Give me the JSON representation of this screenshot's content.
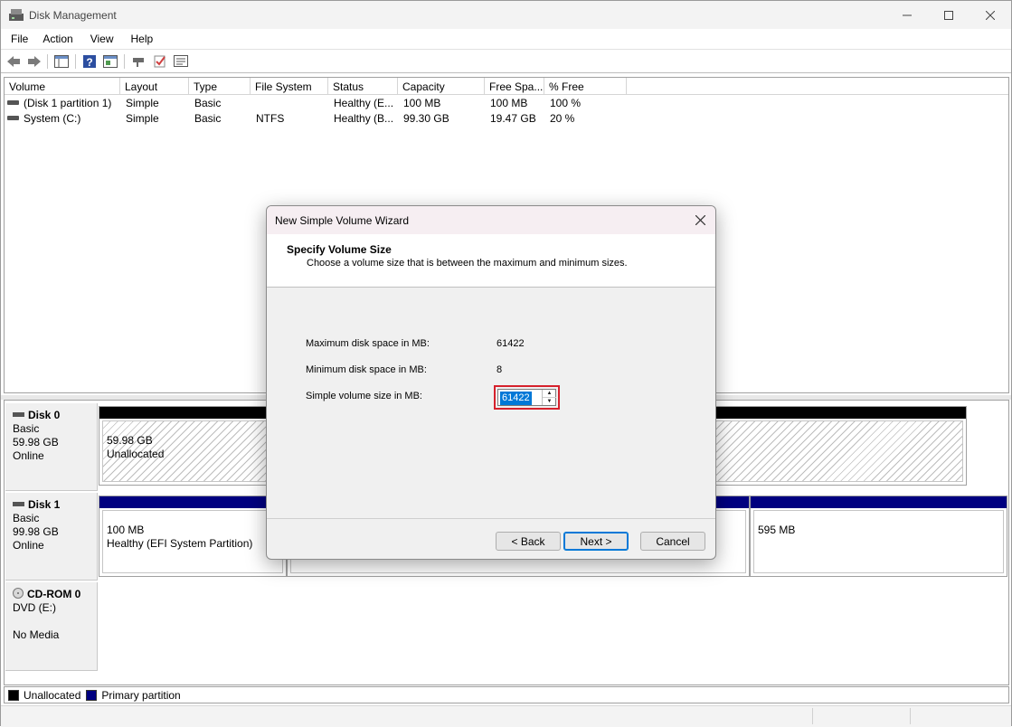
{
  "window": {
    "title": "Disk Management"
  },
  "menu": [
    "File",
    "Action",
    "View",
    "Help"
  ],
  "volume_list": {
    "columns": [
      "Volume",
      "Layout",
      "Type",
      "File System",
      "Status",
      "Capacity",
      "Free Spa...",
      "% Free"
    ],
    "rows": [
      [
        "(Disk 1 partition 1)",
        "Simple",
        "Basic",
        "",
        "Healthy (E...",
        "100 MB",
        "100 MB",
        "100 %"
      ],
      [
        "System (C:)",
        "Simple",
        "Basic",
        "NTFS",
        "Healthy (B...",
        "99.30 GB",
        "19.47 GB",
        "20 %"
      ]
    ]
  },
  "disks": {
    "disk0": {
      "name": "Disk 0",
      "type": "Basic",
      "size": "59.98 GB",
      "state": "Online",
      "partition": {
        "size": "59.98 GB",
        "label": "Unallocated"
      }
    },
    "disk1": {
      "name": "Disk 1",
      "type": "Basic",
      "size": "99.98 GB",
      "state": "Online",
      "partition1": {
        "size": "100 MB",
        "label": "Healthy (EFI System Partition)"
      },
      "partition3": {
        "size": "595 MB"
      }
    },
    "cdrom0": {
      "name": "CD-ROM 0",
      "type": "DVD (E:)",
      "state": "No Media"
    }
  },
  "legend": [
    "Unallocated",
    "Primary partition"
  ],
  "colors": {
    "unallocated": "#000000",
    "primary": "#000080",
    "highlight": "#d6212c",
    "selection": "#0078d7"
  },
  "dialog": {
    "title": "New Simple Volume Wizard",
    "heading": "Specify Volume Size",
    "subheading": "Choose a volume size that is between the maximum and minimum sizes.",
    "max_label": "Maximum disk space in MB:",
    "max_value": "61422",
    "min_label": "Minimum disk space in MB:",
    "min_value": "8",
    "size_label": "Simple volume size in MB:",
    "size_value": "61422",
    "back": "< Back",
    "next": "Next >",
    "cancel": "Cancel"
  }
}
